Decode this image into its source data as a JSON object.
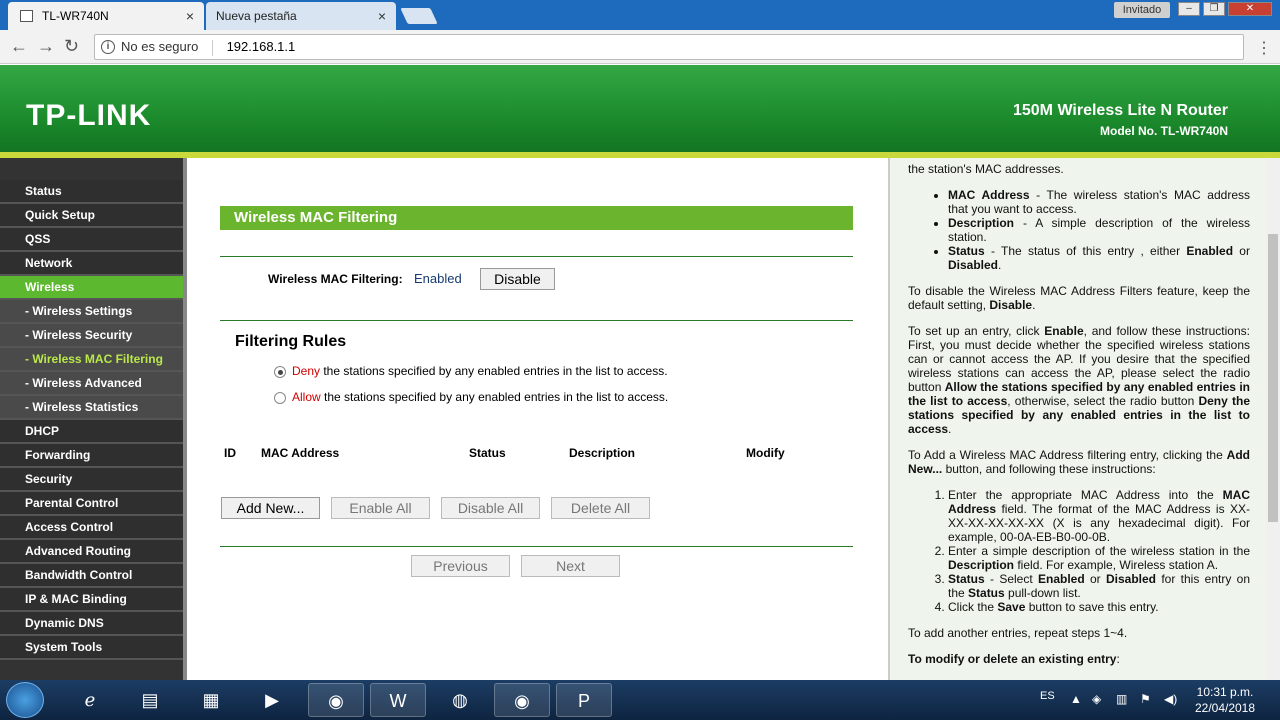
{
  "browser": {
    "tabs": [
      {
        "label": "TL-WR740N"
      },
      {
        "label": "Nueva pestaña"
      }
    ],
    "profile_label": "Invitado",
    "security_label": "No es seguro",
    "url": "192.168.1.1",
    "icons": {
      "back": "←",
      "forward": "→",
      "reload": "↻",
      "info": "i",
      "menu": "⋮",
      "close": "×"
    }
  },
  "banner": {
    "logo": "TP-LINK",
    "title": "150M Wireless Lite N Router",
    "model": "Model No. TL-WR740N",
    "colors": {
      "green": "#1b8a2c",
      "stripe": "#c9d93b"
    }
  },
  "sidebar": {
    "items": [
      {
        "label": "Status"
      },
      {
        "label": "Quick Setup"
      },
      {
        "label": "QSS"
      },
      {
        "label": "Network"
      },
      {
        "label": "Wireless"
      },
      {
        "label": "- Wireless Settings"
      },
      {
        "label": "- Wireless Security"
      },
      {
        "label": "- Wireless MAC Filtering"
      },
      {
        "label": "- Wireless Advanced"
      },
      {
        "label": "- Wireless Statistics"
      },
      {
        "label": "DHCP"
      },
      {
        "label": "Forwarding"
      },
      {
        "label": "Security"
      },
      {
        "label": "Parental Control"
      },
      {
        "label": "Access Control"
      },
      {
        "label": "Advanced Routing"
      },
      {
        "label": "Bandwidth Control"
      },
      {
        "label": "IP & MAC Binding"
      },
      {
        "label": "Dynamic DNS"
      },
      {
        "label": "System Tools"
      }
    ],
    "active_color": "#5cb82e"
  },
  "main": {
    "section_title": "Wireless MAC Filtering",
    "mf_label": "Wireless MAC Filtering:",
    "mf_value": "Enabled",
    "disable_button": "Disable",
    "rules_title": "Filtering Rules",
    "rule_deny_word": "Deny",
    "rule_deny_text": " the stations specified by any enabled entries in the list to access.",
    "rule_allow_word": "Allow",
    "rule_allow_text": " the stations specified by any enabled entries in the list to access.",
    "table_headers": [
      "ID",
      "MAC Address",
      "Status",
      "Description",
      "Modify"
    ],
    "buttons": {
      "add_new": "Add New...",
      "enable_all": "Enable All",
      "disable_all": "Disable All",
      "delete_all": "Delete All",
      "previous": "Previous",
      "next": "Next"
    }
  },
  "help": {
    "intro_tail": "the station's MAC addresses.",
    "list1": [
      {
        "bold": "MAC Address",
        "text": " - The wireless station's MAC address that you want to access."
      },
      {
        "bold": "Description",
        "text": " - A simple description of the wireless station."
      },
      {
        "bold": "Status",
        "text": " - The status of this entry , either ",
        "bold2": "Enabled",
        "text2": " or ",
        "bold3": "Disabled",
        "text3": "."
      }
    ],
    "p_disable_a": "To disable the Wireless MAC Address Filters feature, keep the default setting, ",
    "p_disable_b": "Disable",
    "p_disable_c": ".",
    "p_setup_a": "To set up an entry, click ",
    "p_setup_b": "Enable",
    "p_setup_c": ", and follow these instructions: First, you must decide whether the specified wireless stations can or cannot access the AP. If you desire that the specified wireless stations can access the AP, please select the radio button ",
    "p_setup_d": "Allow the stations specified by any enabled entries in the list to access",
    "p_setup_e": ", otherwise, select the radio button ",
    "p_setup_f": "Deny the stations specified by any enabled entries in the list to access",
    "p_setup_g": ".",
    "p_add_a": "To Add a Wireless MAC Address filtering entry, clicking the ",
    "p_add_b": "Add New...",
    "p_add_c": " button, and following these instructions:",
    "steps": [
      {
        "a": "Enter the appropriate MAC Address into the ",
        "b": "MAC Address",
        "c": " field. The format of the MAC Address is XX-XX-XX-XX-XX-XX (X is any hexadecimal digit). For example, 00-0A-EB-B0-00-0B."
      },
      {
        "a": "Enter a simple description of the wireless station in the ",
        "b": "Description",
        "c": " field. For example, Wireless station A."
      },
      {
        "a": "",
        "b": "Status",
        "c": " - Select ",
        "d": "Enabled",
        "e": " or ",
        "f": "Disabled",
        "g": " for this entry on the ",
        "h": "Status",
        "i": " pull-down list."
      },
      {
        "a": "Click the ",
        "b": "Save",
        "c": " button to save this entry."
      }
    ],
    "p_repeat": "To add another entries, repeat steps 1~4.",
    "p_modify_a": "To modify or delete an existing entry",
    "p_modify_b": ":"
  },
  "taskbar": {
    "lang": "ES",
    "time": "10:31 p.m.",
    "date": "22/04/2018",
    "apps": [
      "ie-icon",
      "explorer-icon",
      "calculator-icon",
      "media-player-icon",
      "chrome-icon",
      "word-icon",
      "firefox-icon",
      "chrome-icon",
      "powerpoint-icon"
    ]
  }
}
